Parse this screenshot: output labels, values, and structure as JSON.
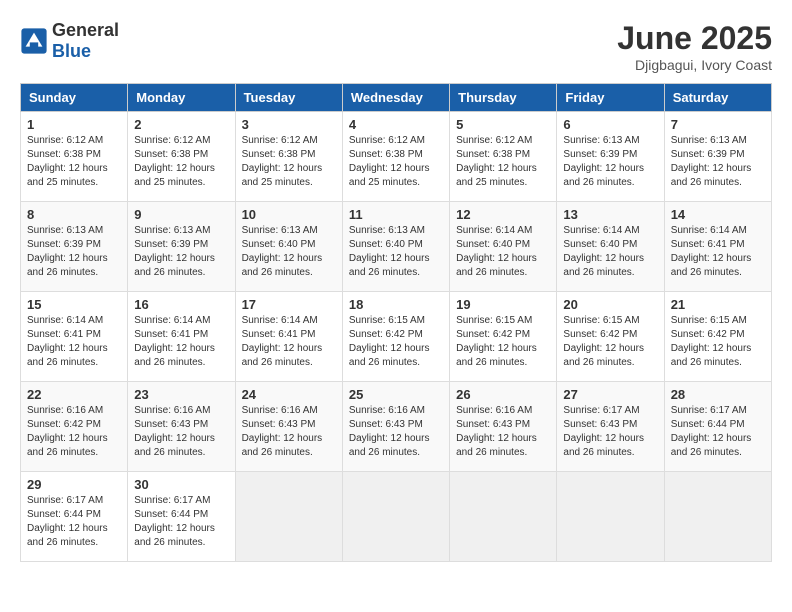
{
  "header": {
    "logo_general": "General",
    "logo_blue": "Blue",
    "title": "June 2025",
    "subtitle": "Djigbagui, Ivory Coast"
  },
  "calendar": {
    "columns": [
      "Sunday",
      "Monday",
      "Tuesday",
      "Wednesday",
      "Thursday",
      "Friday",
      "Saturday"
    ],
    "weeks": [
      [
        {
          "day": "1",
          "info": "Sunrise: 6:12 AM\nSunset: 6:38 PM\nDaylight: 12 hours\nand 25 minutes."
        },
        {
          "day": "2",
          "info": "Sunrise: 6:12 AM\nSunset: 6:38 PM\nDaylight: 12 hours\nand 25 minutes."
        },
        {
          "day": "3",
          "info": "Sunrise: 6:12 AM\nSunset: 6:38 PM\nDaylight: 12 hours\nand 25 minutes."
        },
        {
          "day": "4",
          "info": "Sunrise: 6:12 AM\nSunset: 6:38 PM\nDaylight: 12 hours\nand 25 minutes."
        },
        {
          "day": "5",
          "info": "Sunrise: 6:12 AM\nSunset: 6:38 PM\nDaylight: 12 hours\nand 25 minutes."
        },
        {
          "day": "6",
          "info": "Sunrise: 6:13 AM\nSunset: 6:39 PM\nDaylight: 12 hours\nand 26 minutes."
        },
        {
          "day": "7",
          "info": "Sunrise: 6:13 AM\nSunset: 6:39 PM\nDaylight: 12 hours\nand 26 minutes."
        }
      ],
      [
        {
          "day": "8",
          "info": "Sunrise: 6:13 AM\nSunset: 6:39 PM\nDaylight: 12 hours\nand 26 minutes."
        },
        {
          "day": "9",
          "info": "Sunrise: 6:13 AM\nSunset: 6:39 PM\nDaylight: 12 hours\nand 26 minutes."
        },
        {
          "day": "10",
          "info": "Sunrise: 6:13 AM\nSunset: 6:40 PM\nDaylight: 12 hours\nand 26 minutes."
        },
        {
          "day": "11",
          "info": "Sunrise: 6:13 AM\nSunset: 6:40 PM\nDaylight: 12 hours\nand 26 minutes."
        },
        {
          "day": "12",
          "info": "Sunrise: 6:14 AM\nSunset: 6:40 PM\nDaylight: 12 hours\nand 26 minutes."
        },
        {
          "day": "13",
          "info": "Sunrise: 6:14 AM\nSunset: 6:40 PM\nDaylight: 12 hours\nand 26 minutes."
        },
        {
          "day": "14",
          "info": "Sunrise: 6:14 AM\nSunset: 6:41 PM\nDaylight: 12 hours\nand 26 minutes."
        }
      ],
      [
        {
          "day": "15",
          "info": "Sunrise: 6:14 AM\nSunset: 6:41 PM\nDaylight: 12 hours\nand 26 minutes."
        },
        {
          "day": "16",
          "info": "Sunrise: 6:14 AM\nSunset: 6:41 PM\nDaylight: 12 hours\nand 26 minutes."
        },
        {
          "day": "17",
          "info": "Sunrise: 6:14 AM\nSunset: 6:41 PM\nDaylight: 12 hours\nand 26 minutes."
        },
        {
          "day": "18",
          "info": "Sunrise: 6:15 AM\nSunset: 6:42 PM\nDaylight: 12 hours\nand 26 minutes."
        },
        {
          "day": "19",
          "info": "Sunrise: 6:15 AM\nSunset: 6:42 PM\nDaylight: 12 hours\nand 26 minutes."
        },
        {
          "day": "20",
          "info": "Sunrise: 6:15 AM\nSunset: 6:42 PM\nDaylight: 12 hours\nand 26 minutes."
        },
        {
          "day": "21",
          "info": "Sunrise: 6:15 AM\nSunset: 6:42 PM\nDaylight: 12 hours\nand 26 minutes."
        }
      ],
      [
        {
          "day": "22",
          "info": "Sunrise: 6:16 AM\nSunset: 6:42 PM\nDaylight: 12 hours\nand 26 minutes."
        },
        {
          "day": "23",
          "info": "Sunrise: 6:16 AM\nSunset: 6:43 PM\nDaylight: 12 hours\nand 26 minutes."
        },
        {
          "day": "24",
          "info": "Sunrise: 6:16 AM\nSunset: 6:43 PM\nDaylight: 12 hours\nand 26 minutes."
        },
        {
          "day": "25",
          "info": "Sunrise: 6:16 AM\nSunset: 6:43 PM\nDaylight: 12 hours\nand 26 minutes."
        },
        {
          "day": "26",
          "info": "Sunrise: 6:16 AM\nSunset: 6:43 PM\nDaylight: 12 hours\nand 26 minutes."
        },
        {
          "day": "27",
          "info": "Sunrise: 6:17 AM\nSunset: 6:43 PM\nDaylight: 12 hours\nand 26 minutes."
        },
        {
          "day": "28",
          "info": "Sunrise: 6:17 AM\nSunset: 6:44 PM\nDaylight: 12 hours\nand 26 minutes."
        }
      ],
      [
        {
          "day": "29",
          "info": "Sunrise: 6:17 AM\nSunset: 6:44 PM\nDaylight: 12 hours\nand 26 minutes."
        },
        {
          "day": "30",
          "info": "Sunrise: 6:17 AM\nSunset: 6:44 PM\nDaylight: 12 hours\nand 26 minutes."
        },
        {
          "day": "",
          "info": ""
        },
        {
          "day": "",
          "info": ""
        },
        {
          "day": "",
          "info": ""
        },
        {
          "day": "",
          "info": ""
        },
        {
          "day": "",
          "info": ""
        }
      ]
    ]
  }
}
